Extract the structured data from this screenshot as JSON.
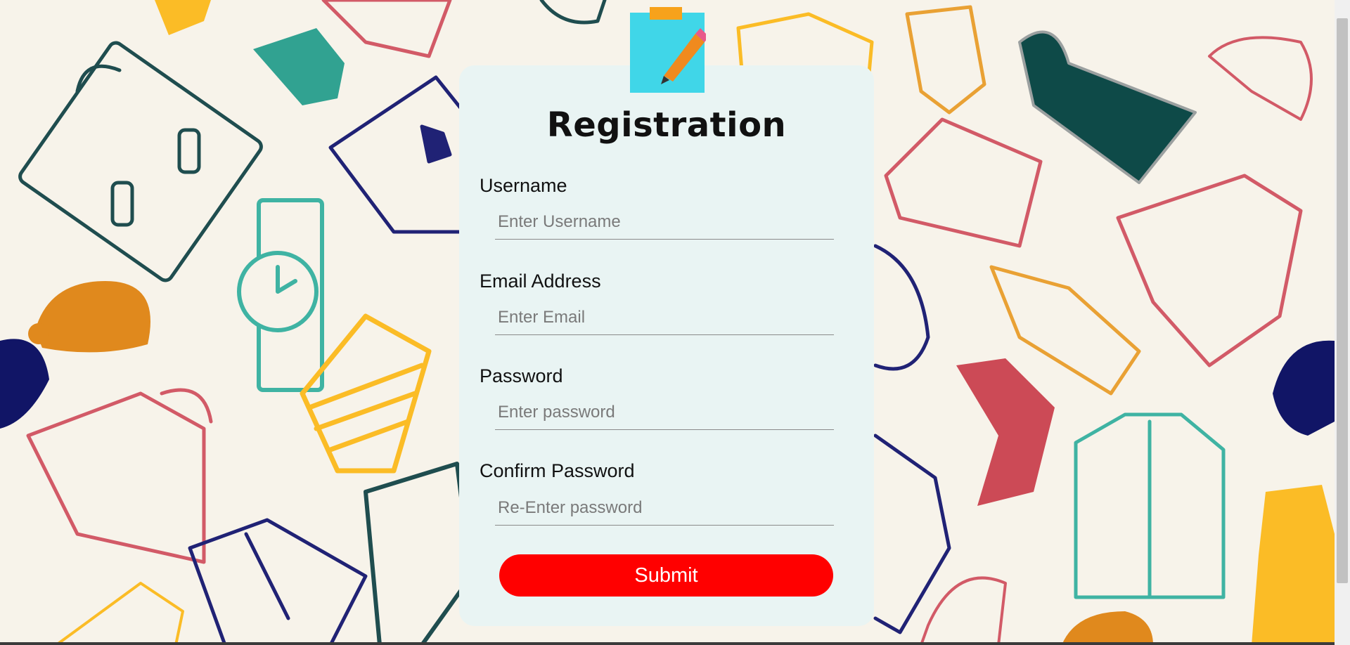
{
  "form": {
    "title": "Registration",
    "username": {
      "label": "Username",
      "placeholder": "Enter Username",
      "value": ""
    },
    "email": {
      "label": "Email Address",
      "placeholder": "Enter Email",
      "value": ""
    },
    "password": {
      "label": "Password",
      "placeholder": "Enter password",
      "value": ""
    },
    "confirm_password": {
      "label": "Confirm Password",
      "placeholder": "Re-Enter password",
      "value": ""
    },
    "submit_label": "Submit"
  },
  "colors": {
    "background": "#f7f3ea",
    "card": "#e9f4f3",
    "submit": "#ff0000",
    "note_icon": "#40d6e8",
    "pencil": "#f08a1e"
  },
  "icons": [
    "notepad-pencil-icon"
  ]
}
